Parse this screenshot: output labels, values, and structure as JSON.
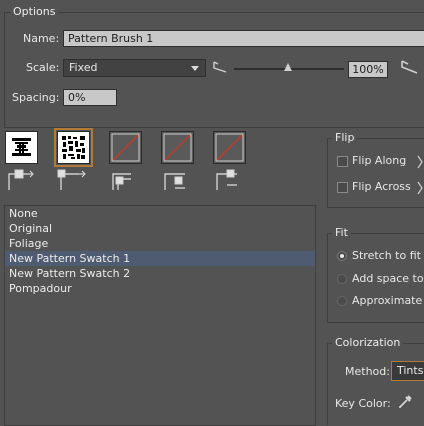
{
  "options": {
    "title": "Options",
    "name_label": "Name:",
    "name_value": "Pattern Brush 1",
    "scale_label": "Scale:",
    "scale_mode": "Fixed",
    "scale_value": "100%",
    "spacing_label": "Spacing:",
    "spacing_value": "0%"
  },
  "tiles": [
    {
      "name": "side-tile",
      "selected": false,
      "has_pattern": true
    },
    {
      "name": "outer-corner-tile",
      "selected": true,
      "has_pattern": true
    },
    {
      "name": "inner-corner-tile",
      "selected": false,
      "has_pattern": false
    },
    {
      "name": "start-tile",
      "selected": false,
      "has_pattern": false
    },
    {
      "name": "end-tile",
      "selected": false,
      "has_pattern": false
    }
  ],
  "swatch_list": {
    "items": [
      "None",
      "Original",
      "Foliage",
      "New Pattern Swatch 1",
      "New Pattern Swatch 2",
      "Pompadour"
    ],
    "selected": "New Pattern Swatch 1"
  },
  "flip": {
    "title": "Flip",
    "along_label": "Flip Along",
    "across_label": "Flip Across"
  },
  "fit": {
    "title": "Fit",
    "stretch_label": "Stretch to fit",
    "add_space_label": "Add space to",
    "approx_label": "Approximate p"
  },
  "colorization": {
    "title": "Colorization",
    "method_label": "Method:",
    "method_value": "Tints",
    "key_color_label": "Key Color:"
  },
  "colors": {
    "panel_bg": "#535353",
    "selection": "#4e5b70",
    "highlight_border": "#b07a3a",
    "none_slash": "#c0392b"
  }
}
